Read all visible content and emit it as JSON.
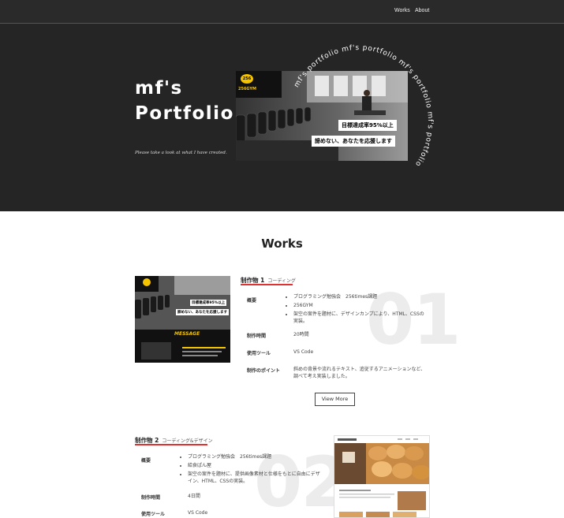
{
  "nav": {
    "items": [
      {
        "label": "Works"
      },
      {
        "label": "About"
      }
    ]
  },
  "hero": {
    "title_line1": "mf's",
    "title_line2": "Portfolio",
    "subtitle": "Please take a look at what I have created.",
    "ring_text": "mf's portfolio mf's portfolio mf's portfolio mf's portfolio ",
    "image": {
      "logo_number": "256",
      "logo_name": "256GYM",
      "badge1": "目標達成率95%以上",
      "badge2": "諦めない、あなたを応援します"
    }
  },
  "works": {
    "heading": "Works",
    "items": [
      {
        "title": "制作物 1",
        "tag": "コーディング",
        "number": "01",
        "rows": {
          "overview_label": "概要",
          "overview": [
            "プログラミング勉強会　256times課題",
            "256GYM",
            "架空の案件を題材に、デザインカンプにより、HTML、CSSの実装。"
          ],
          "time_label": "制作時間",
          "time": "20時間",
          "tools_label": "使用ツール",
          "tools": "VS Code",
          "points_label": "制作のポイント",
          "points": "斜めの背景や流れるテキスト、追従するアニメーションなど、調べて考え実装しました。"
        },
        "thumb": {
          "badge1": "目標達成率95%以上",
          "badge2": "諦めない、あなたを応援します",
          "message": "MESSAGE"
        },
        "view_more": "View More"
      },
      {
        "title": "制作物 2",
        "tag": "コーディング&デザイン",
        "number": "02",
        "rows": {
          "overview_label": "概要",
          "overview": [
            "プログラミング勉強会　256times課題",
            "給食ぱん屋",
            "架空の案件を題材に、提供画像素材と仕様をもとに自由にデザイン、HTML、CSSの実装。"
          ],
          "time_label": "制作時間",
          "time": "4日間",
          "tools_label": "使用ツール",
          "tools": "VS Code"
        }
      }
    ]
  },
  "colors": {
    "dark_bg": "#252525",
    "accent_red": "#d33333",
    "gym_yellow": "#f5c400"
  }
}
